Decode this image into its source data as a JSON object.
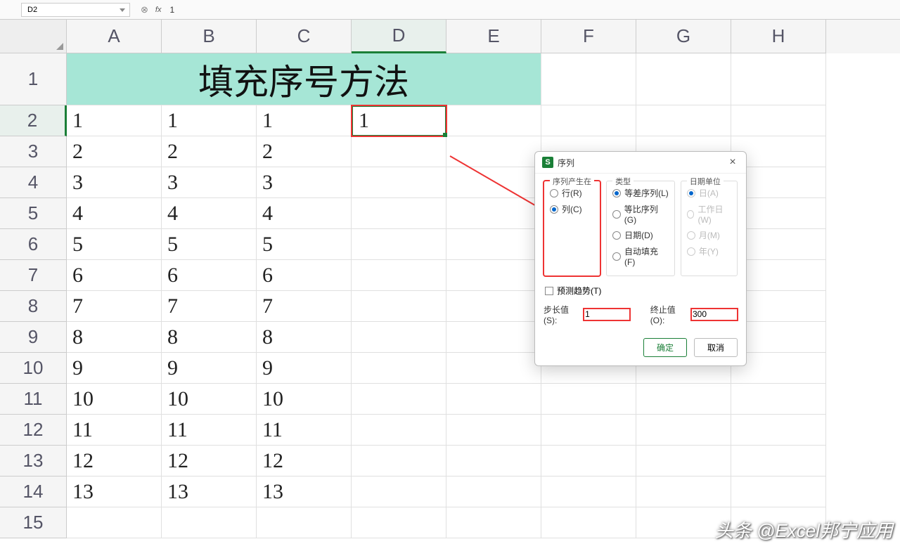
{
  "formula_bar": {
    "name_box": "D2",
    "fx": "fx",
    "value": "1"
  },
  "columns": [
    "A",
    "B",
    "C",
    "D",
    "E",
    "F",
    "G",
    "H"
  ],
  "selected_col_index": 3,
  "title_cell": "填充序号方法",
  "row_numbers": [
    "1",
    "2",
    "3",
    "4",
    "5",
    "6",
    "7",
    "8",
    "9",
    "10",
    "11",
    "12",
    "13",
    "14",
    "15"
  ],
  "data_cols": {
    "A": [
      "1",
      "2",
      "3",
      "4",
      "5",
      "6",
      "7",
      "8",
      "9",
      "10",
      "11",
      "12",
      "13"
    ],
    "B": [
      "1",
      "2",
      "3",
      "4",
      "5",
      "6",
      "7",
      "8",
      "9",
      "10",
      "11",
      "12",
      "13"
    ],
    "C": [
      "1",
      "2",
      "3",
      "4",
      "5",
      "6",
      "7",
      "8",
      "9",
      "10",
      "11",
      "12",
      "13"
    ],
    "D": [
      "1",
      "",
      "",
      "",
      "",
      "",
      "",
      "",
      "",
      "",
      "",
      "",
      ""
    ]
  },
  "dialog": {
    "title": "序列",
    "group_generate": "序列产生在",
    "opt_row": "行(R)",
    "opt_col": "列(C)",
    "group_type": "类型",
    "opt_arith": "等差序列(L)",
    "opt_geom": "等比序列(G)",
    "opt_date": "日期(D)",
    "opt_autofill": "自动填充(F)",
    "group_dateunit": "日期单位",
    "opt_day": "日(A)",
    "opt_workday": "工作日(W)",
    "opt_month": "月(M)",
    "opt_year": "年(Y)",
    "predict": "预测趋势(T)",
    "step_label": "步长值(S):",
    "step_value": "1",
    "stop_label": "终止值(O):",
    "stop_value": "300",
    "ok": "确定",
    "cancel": "取消"
  },
  "watermark": "头条 @Excel邦宁应用",
  "chart_data": {
    "type": "table",
    "title": "填充序号方法",
    "columns": [
      "A",
      "B",
      "C",
      "D"
    ],
    "rows": [
      [
        1,
        1,
        1,
        1
      ],
      [
        2,
        2,
        2,
        null
      ],
      [
        3,
        3,
        3,
        null
      ],
      [
        4,
        4,
        4,
        null
      ],
      [
        5,
        5,
        5,
        null
      ],
      [
        6,
        6,
        6,
        null
      ],
      [
        7,
        7,
        7,
        null
      ],
      [
        8,
        8,
        8,
        null
      ],
      [
        9,
        9,
        9,
        null
      ],
      [
        10,
        10,
        10,
        null
      ],
      [
        11,
        11,
        11,
        null
      ],
      [
        12,
        12,
        12,
        null
      ],
      [
        13,
        13,
        13,
        null
      ]
    ]
  }
}
